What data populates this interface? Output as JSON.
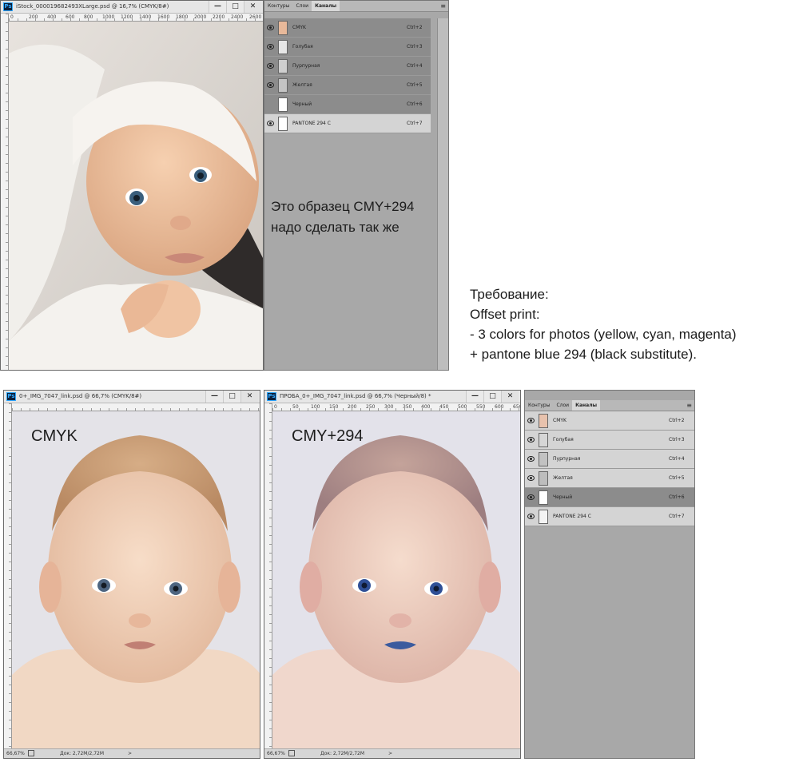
{
  "window_top": {
    "title": "iStock_000019682493XLarge.psd @ 16,7% (CMYK/8#)",
    "ruler": [
      "0",
      "200",
      "400",
      "600",
      "800",
      "1000",
      "1200",
      "1400",
      "1600",
      "1800",
      "2000",
      "2200",
      "2400",
      "2600",
      "2"
    ]
  },
  "panel_top": {
    "tabs": [
      "Контуры",
      "Слои",
      "Каналы"
    ],
    "channels": [
      {
        "name": "CMYK",
        "shortcut": "Ctrl+2"
      },
      {
        "name": "Голубая",
        "shortcut": "Ctrl+3"
      },
      {
        "name": "Пурпурная",
        "shortcut": "Ctrl+4"
      },
      {
        "name": "Желтая",
        "shortcut": "Ctrl+5"
      },
      {
        "name": "Черный",
        "shortcut": "Ctrl+6"
      },
      {
        "name": "PANTONE 294 C",
        "shortcut": "Ctrl+7"
      }
    ],
    "note_line1": "Это образец CMY+294",
    "note_line2": "надо сделать так же"
  },
  "requirement": {
    "line1": "Требование:",
    "line2": "Offset print:",
    "line3": "- 3 colors for photos (yellow, cyan, magenta)",
    "line4": "+ pantone blue 294 (black substitute)."
  },
  "window_left": {
    "title": "0+_IMG_7047_link.psd @ 66,7% (CMYK/8#)",
    "label": "CMYK",
    "zoom": "66,67%",
    "docsize": "Док: 2,72M/2,72M",
    "arrow": ">"
  },
  "window_right": {
    "title": "ПРОБА_0+_IMG_7047_link.psd @ 66,7% (Черный/8) *",
    "label": "CMY+294",
    "ruler": [
      "0",
      "50",
      "100",
      "150",
      "200",
      "250",
      "300",
      "350",
      "400",
      "450",
      "500",
      "550",
      "600",
      "650"
    ],
    "zoom": "66,67%",
    "docsize": "Док: 2,72M/2,72M",
    "arrow": ">"
  },
  "panel_bottom": {
    "tabs": [
      "Контуры",
      "Слои",
      "Каналы"
    ],
    "channels": [
      {
        "name": "CMYK",
        "shortcut": "Ctrl+2"
      },
      {
        "name": "Голубая",
        "shortcut": "Ctrl+3"
      },
      {
        "name": "Пурпурная",
        "shortcut": "Ctrl+4"
      },
      {
        "name": "Желтая",
        "shortcut": "Ctrl+5"
      },
      {
        "name": "Черный",
        "shortcut": "Ctrl+6"
      },
      {
        "name": "PANTONE 294 C",
        "shortcut": "Ctrl+7"
      }
    ]
  },
  "window_buttons": {
    "minimize": "—",
    "maximize": "□",
    "close": "✕"
  }
}
